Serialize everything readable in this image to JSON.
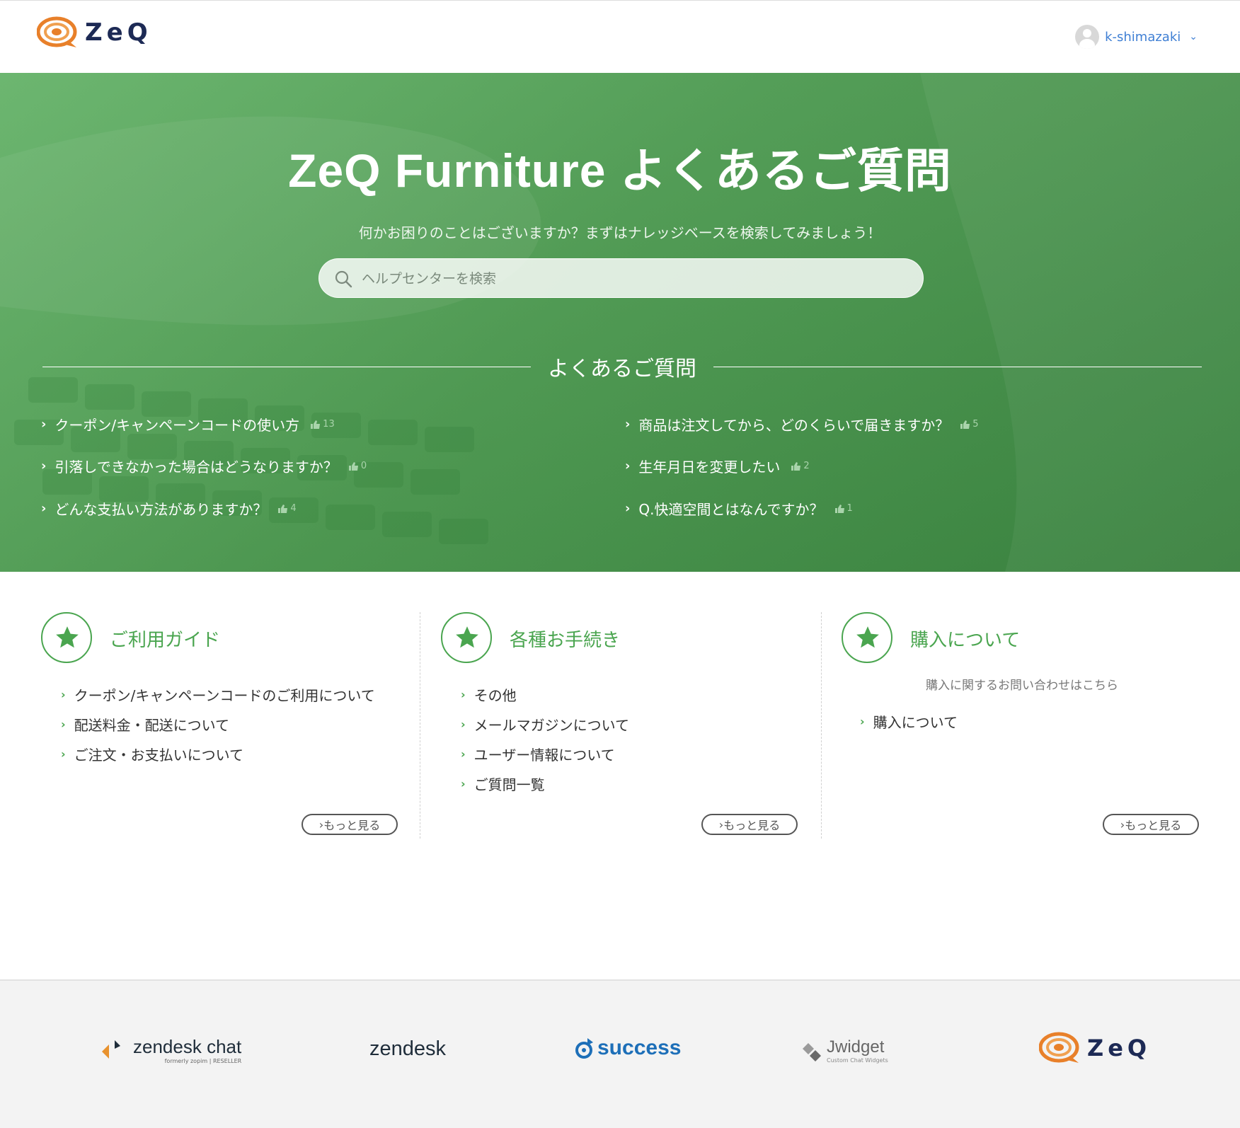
{
  "header": {
    "logo_text": "ZeQ",
    "user_name": "k-shimazaki",
    "user_caret": "⌄"
  },
  "hero": {
    "title": "ZeQ Furniture よくあるご質問",
    "subtitle": "何かお困りのことはございますか？まずはナレッジベースを検索してみましょう！",
    "search_placeholder": "ヘルプセンターを検索",
    "faq_heading": "よくあるご質問",
    "faq_items": [
      {
        "label": "クーポン/キャンペーンコードの使い方",
        "votes": "13"
      },
      {
        "label": "商品は注文してから、どのくらいで届きますか？",
        "votes": "5"
      },
      {
        "label": "引落しできなかった場合はどうなりますか？",
        "votes": "0"
      },
      {
        "label": "生年月日を変更したい",
        "votes": "2"
      },
      {
        "label": "どんな支払い方法がありますか？",
        "votes": "4"
      },
      {
        "label": "Q.快適空間とはなんですか？",
        "votes": "1"
      }
    ]
  },
  "categories": [
    {
      "title": "ご利用ガイド",
      "description": "",
      "links": [
        "クーポン/キャンペーンコードのご利用について",
        "配送料金・配送について",
        "ご注文・お支払いについて"
      ],
      "more": "もっと見る"
    },
    {
      "title": "各種お手続き",
      "description": "",
      "links": [
        "その他",
        "メールマガジンについて",
        "ユーザー情報について",
        "ご質問一覧"
      ],
      "more": "もっと見る"
    },
    {
      "title": "購入について",
      "description": "購入に関するお問い合わせはこちら",
      "links": [
        "購入について"
      ],
      "more": "もっと見る"
    }
  ],
  "footer": {
    "partners": {
      "zendesk_chat": "zendesk chat",
      "zendesk_chat_sub": "formerly zopim | RESELLER",
      "zendesk": "zendesk",
      "success": "success",
      "jwidget": "Jwidget",
      "jwidget_sub": "Custom Chat Widgets",
      "zeq": "ZeQ"
    }
  },
  "colors": {
    "brand_green": "#4aa54f",
    "hero_green": "#4a9c4e",
    "link_blue": "#3f7fd4",
    "logo_orange": "#e8802a",
    "logo_navy": "#1d2a55"
  }
}
